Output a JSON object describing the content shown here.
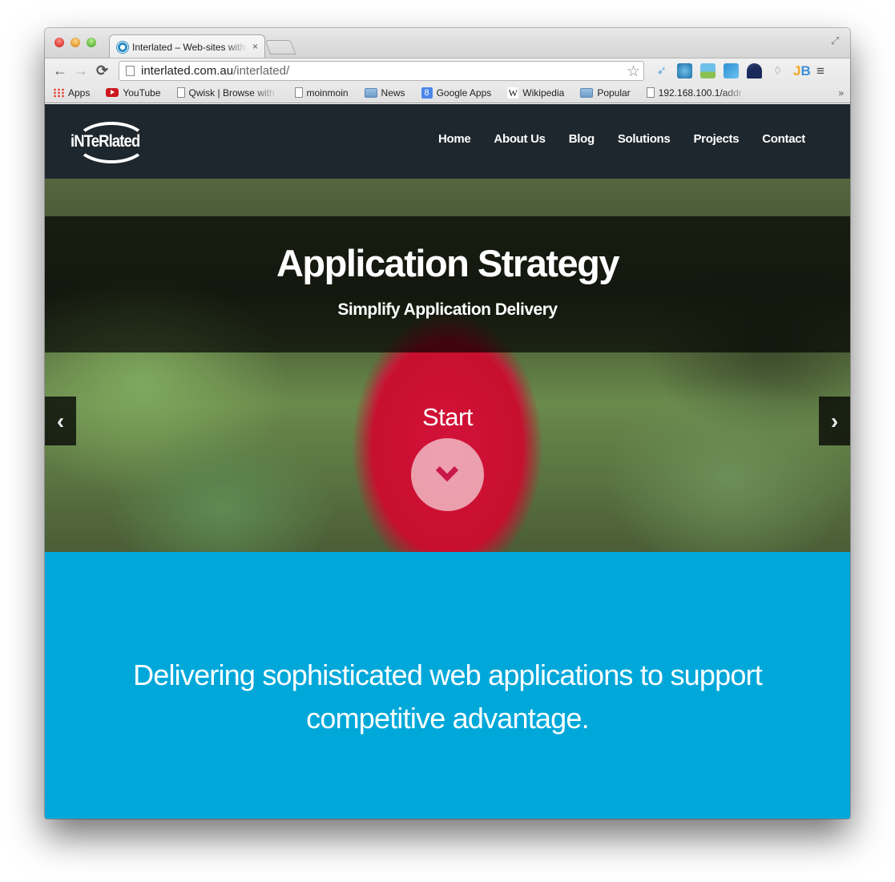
{
  "browser": {
    "tab": {
      "title": "Interlated – Web-sites with",
      "close_symbol": "×"
    },
    "address_bar": {
      "host": "interlated.com.au",
      "path": "/interlated/"
    },
    "nav": {
      "back": "←",
      "forward": "→",
      "reload": "C"
    },
    "star_symbol": "☆",
    "extensions": [
      "twitter-icon",
      "seo-icon",
      "landscape-icon",
      "photos-icon",
      "speed-icon",
      "mask-icon",
      "jb-icon"
    ],
    "jb_label": {
      "j": "J",
      "b": "B"
    },
    "menu_symbol": "≡",
    "bookmarks": [
      {
        "label": "Apps",
        "icon": "apps-grid-icon"
      },
      {
        "label": "YouTube",
        "icon": "youtube-icon"
      },
      {
        "label": "Qwisk | Browse with",
        "icon": "page-icon"
      },
      {
        "label": "moinmoin",
        "icon": "page-icon"
      },
      {
        "label": "News",
        "icon": "folder-icon"
      },
      {
        "label": "Google Apps",
        "icon": "google-apps-icon"
      },
      {
        "label": "Wikipedia",
        "icon": "wikipedia-icon"
      },
      {
        "label": "Popular",
        "icon": "folder-icon"
      },
      {
        "label": "192.168.100.1/addr",
        "icon": "page-icon"
      }
    ],
    "bookmarks_overflow": "»",
    "google_glyph": "8",
    "wiki_glyph": "W"
  },
  "site": {
    "logo_text": "iNTeRlated",
    "nav": [
      "Home",
      "About Us",
      "Blog",
      "Solutions",
      "Projects",
      "Contact"
    ],
    "hero": {
      "title": "Application Strategy",
      "subtitle": "Simplify Application Delivery",
      "start_label": "Start",
      "prev_symbol": "‹",
      "next_symbol": "›"
    },
    "intro": {
      "text": "Delivering sophisticated web applications to support competitive advantage."
    },
    "colors": {
      "header_bg": "#1f272e",
      "intro_bg": "#00a8da",
      "accent_chevron": "#c8184a"
    }
  }
}
